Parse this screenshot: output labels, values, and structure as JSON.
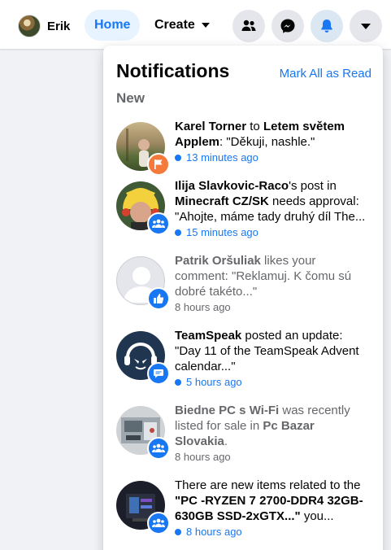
{
  "topbar": {
    "profile_name": "Erik",
    "nav_home": "Home",
    "nav_create": "Create"
  },
  "notifications_panel": {
    "title": "Notifications",
    "mark_all_read": "Mark All as Read",
    "section_new": "New",
    "items": [
      {
        "actor": "Karel Torner",
        "middle": " to ",
        "target": "Letem světem Applem",
        "rest": ": \"Děkuji, nashle.\"",
        "time": "13 minutes ago",
        "unread": true,
        "badge_icon": "flag-icon",
        "badge_color": "#f5793a"
      },
      {
        "actor": "Ilija Slavkovic-Raco",
        "middle": "'s post in ",
        "target": "Minecraft CZ/SK",
        "rest": " needs approval: \"Ahojte, máme tady druhý díl The...",
        "time": "15 minutes ago",
        "unread": true,
        "badge_icon": "group-icon",
        "badge_color": "#1877f2"
      },
      {
        "actor": "Patrik Oršuliak",
        "middle": " likes your comment: \"Reklamuj. K čomu sú dobré takéto...\"",
        "target": "",
        "rest": "",
        "time": "8 hours ago",
        "unread": false,
        "badge_icon": "thumbs-up-icon",
        "badge_color": "#1877f2"
      },
      {
        "actor": "TeamSpeak",
        "middle": " posted an update: \"Day 11 of the TeamSpeak Advent calendar...\"",
        "target": "",
        "rest": "",
        "time": "5 hours ago",
        "unread": true,
        "badge_icon": "comment-icon",
        "badge_color": "#1877f2"
      },
      {
        "actor": "Biedne PC s Wi-Fi",
        "middle": " was recently listed for sale in ",
        "target": "Pc Bazar Slovakia",
        "rest": ".",
        "time": "8 hours ago",
        "unread": false,
        "badge_icon": "group-icon",
        "badge_color": "#1877f2"
      },
      {
        "actor": "",
        "middle": "There are new items related to the ",
        "target": "\"PC -RYZEN 7 2700-DDR4 32GB-630GB SSD-2xGTX...\"",
        "rest": " you...",
        "time": "8 hours ago",
        "unread": true,
        "badge_icon": "group-icon",
        "badge_color": "#1877f2"
      }
    ]
  }
}
